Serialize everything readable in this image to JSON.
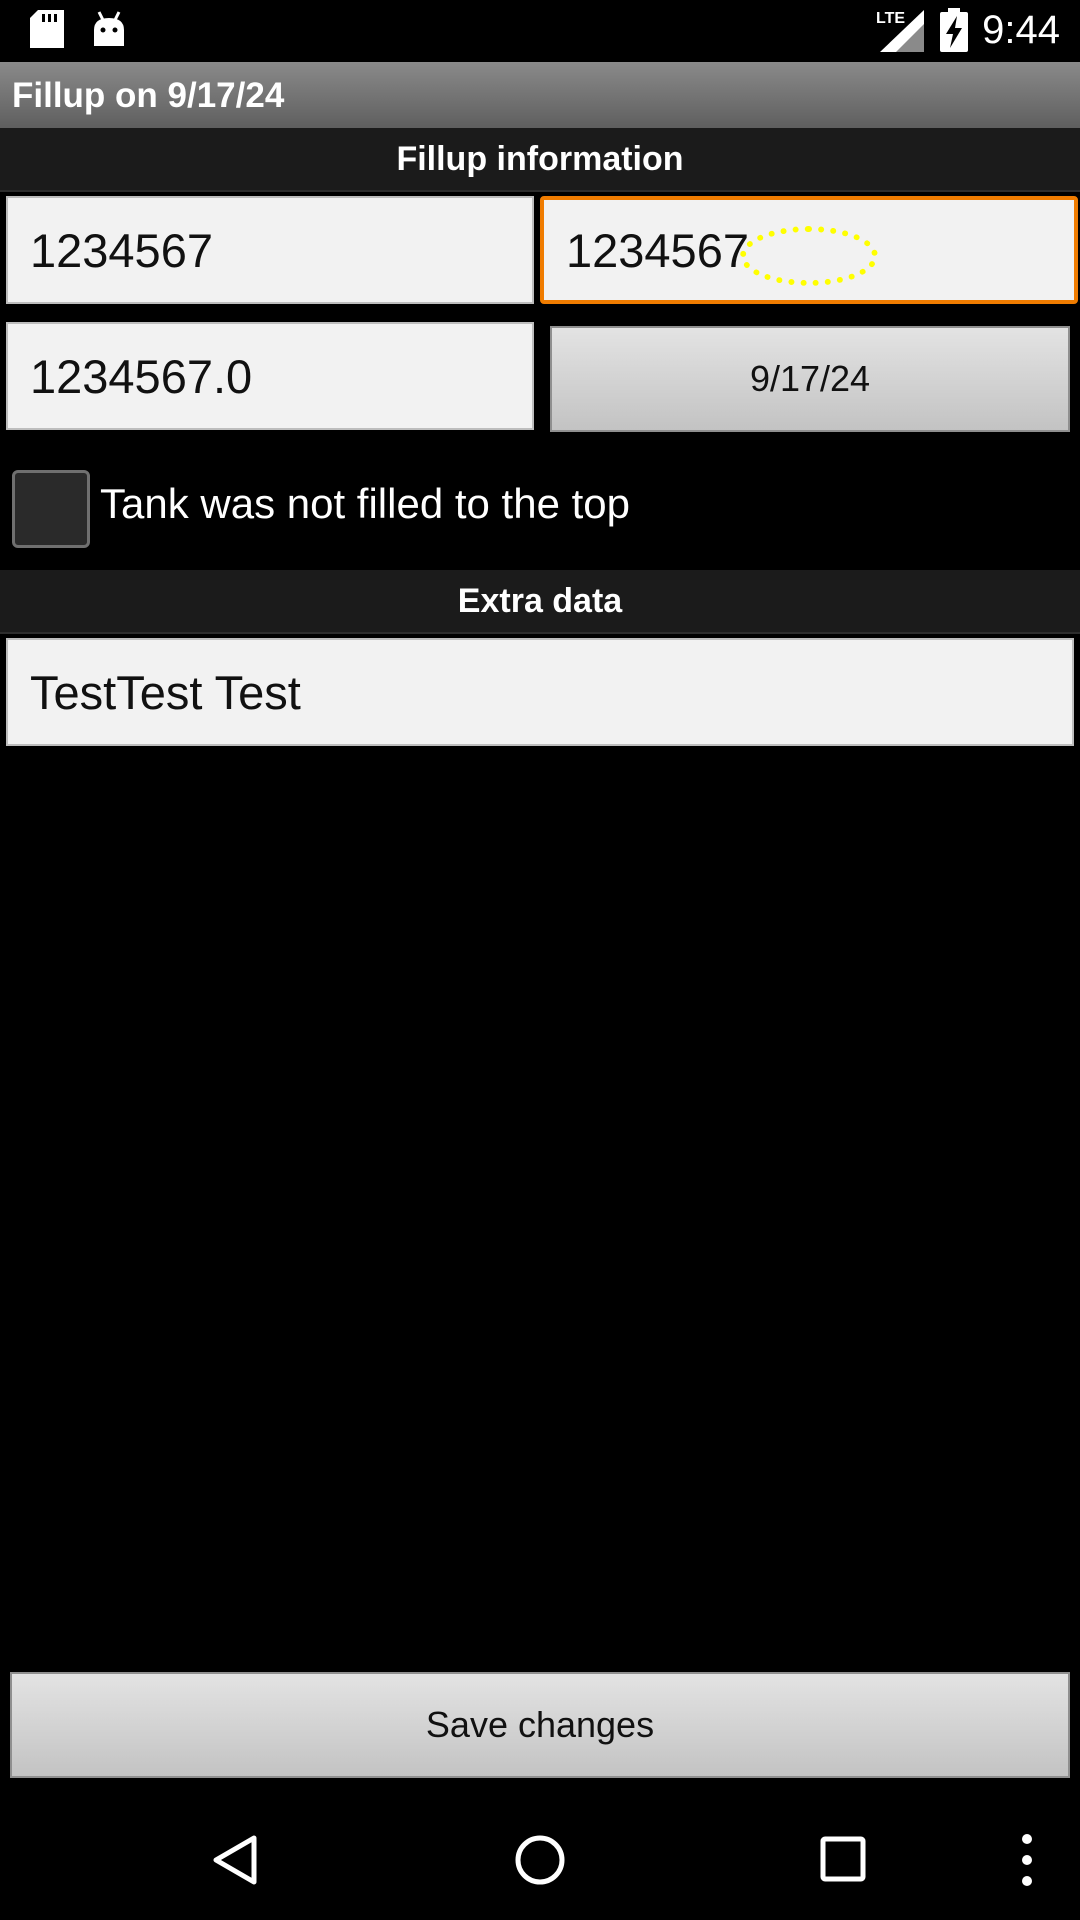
{
  "status_bar": {
    "time": "9:44",
    "network": "LTE",
    "icons": [
      "sd-card-icon",
      "android-icon",
      "signal-icon",
      "battery-charging-icon"
    ]
  },
  "title_bar": {
    "title": "Fillup on 9/17/24"
  },
  "fillup_section": {
    "header": "Fillup information",
    "field_1": "1234567",
    "field_2": "1234567",
    "field_3": "1234567.0",
    "date_button": "9/17/24",
    "checkbox_label": "Tank was not filled to the top",
    "checkbox_checked": false
  },
  "extra_section": {
    "header": "Extra data",
    "comment": "TestTest Test"
  },
  "save_button": "Save changes",
  "colors": {
    "focus": "#f07c00",
    "tap_indicator": "#ffff00"
  }
}
